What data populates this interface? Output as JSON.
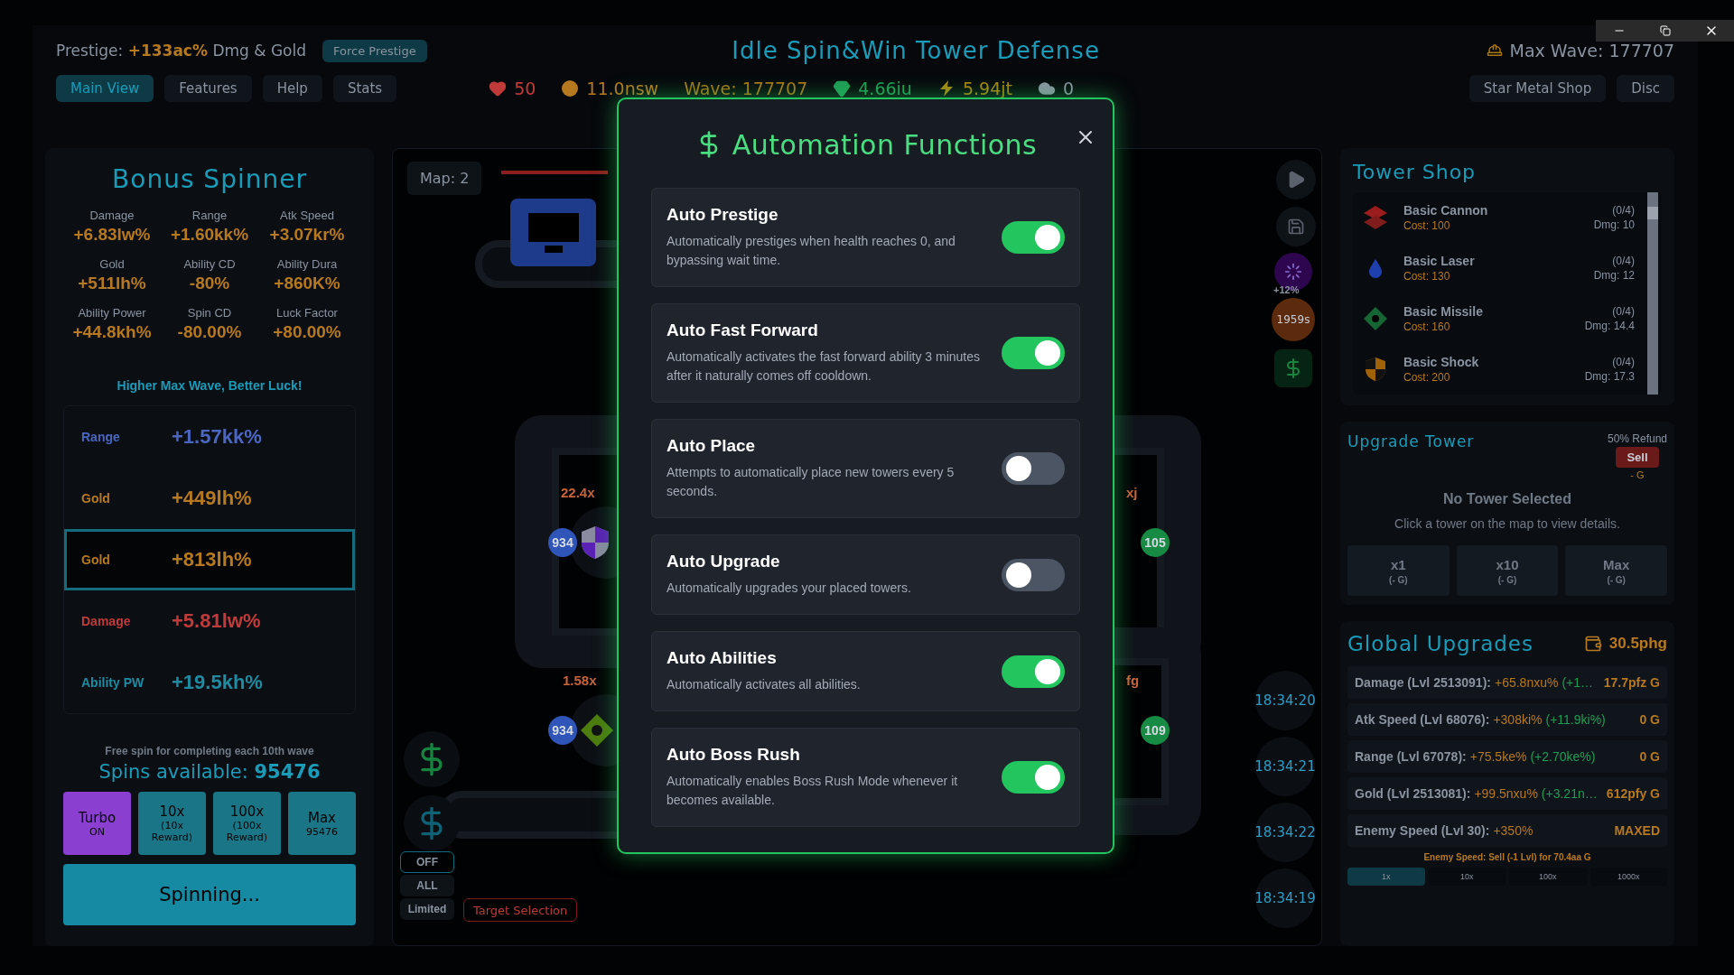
{
  "header": {
    "prestige_label": "Prestige:",
    "prestige_value": "+133ac%",
    "prestige_suffix": "Dmg & Gold",
    "force_prestige": "Force Prestige",
    "title": "Idle Spin&Win Tower Defense",
    "max_wave": "Max Wave: 177707"
  },
  "tabs": [
    {
      "label": "Main View",
      "selected": true
    },
    {
      "label": "Features",
      "selected": false
    },
    {
      "label": "Help",
      "selected": false
    },
    {
      "label": "Stats",
      "selected": false
    }
  ],
  "stats": [
    {
      "kind": "heart",
      "value": "50",
      "color": "#c03a3a"
    },
    {
      "kind": "coin",
      "value": "11.0nsw",
      "color": "#b7791f"
    },
    {
      "kind": "wave",
      "value": "Wave: 177707",
      "color": "#a8760f"
    },
    {
      "kind": "gem",
      "value": "4.66iu",
      "color": "#1f9d55"
    },
    {
      "kind": "bolt",
      "value": "5.94jt",
      "color": "#a8860c"
    },
    {
      "kind": "cloud",
      "value": "0",
      "color": "#8a93a0"
    }
  ],
  "top_links": [
    "Star Metal Shop",
    "Disc"
  ],
  "bonus_spinner": {
    "title": "Bonus Spinner",
    "stats": [
      {
        "label": "Damage",
        "value": "+6.83lw%"
      },
      {
        "label": "Range",
        "value": "+1.60kk%"
      },
      {
        "label": "Atk Speed",
        "value": "+3.07kr%"
      },
      {
        "label": "Gold",
        "value": "+511lh%"
      },
      {
        "label": "Ability CD",
        "value": "-80%"
      },
      {
        "label": "Ability Dura",
        "value": "+860K%"
      },
      {
        "label": "Ability Power",
        "value": "+44.8kh%"
      },
      {
        "label": "Spin CD",
        "value": "-80.00%"
      },
      {
        "label": "Luck Factor",
        "value": "+80.00%"
      }
    ],
    "tagline": "Higher Max Wave, Better Luck!",
    "reel": [
      {
        "label": "Range",
        "value": "+1.57kk%",
        "color": "#4a66c0",
        "selected": false
      },
      {
        "label": "Gold",
        "value": "+449lh%",
        "color": "#b7791f",
        "selected": false
      },
      {
        "label": "Gold",
        "value": "+813lh%",
        "color": "#b7791f",
        "selected": true
      },
      {
        "label": "Damage",
        "value": "+5.81lw%",
        "color": "#c03a3a",
        "selected": false
      },
      {
        "label": "Ability PW",
        "value": "+19.5kh%",
        "color": "#1f8aa0",
        "selected": false
      }
    ],
    "free_spin_note": "Free spin for completing each 10th wave",
    "spins_label": "Spins available:",
    "spins_value": "95476",
    "buttons": [
      {
        "kind": "turbo",
        "label": "Turbo",
        "sub": "ON"
      },
      {
        "kind": "batch",
        "label": "10x",
        "sub": "(10x Reward)"
      },
      {
        "kind": "batch",
        "label": "100x",
        "sub": "(100x Reward)"
      },
      {
        "kind": "batch",
        "label": "Max",
        "sub": "95476"
      }
    ],
    "spin_button": "Spinning..."
  },
  "map": {
    "label": "Map: 2",
    "towers": [
      {
        "kind": "shield",
        "badge": "934",
        "multiplier": "22.4x",
        "color": "#2f55b8"
      },
      {
        "kind": "diamond",
        "badge": "934",
        "multiplier": "1.58x",
        "color": "#2f55b8"
      },
      {
        "badge": "105",
        "multiplier": "xj",
        "color": "#178a44"
      },
      {
        "badge": "109",
        "multiplier": "fg",
        "color": "#178a44"
      }
    ],
    "boost": "+12%",
    "timer": "1959s",
    "clocks": [
      "18:34:20",
      "18:34:21",
      "18:34:22",
      "18:34:19"
    ],
    "target_modes": [
      "OFF",
      "ALL",
      "Limited"
    ],
    "target_selection": "Target Selection"
  },
  "tower_shop": {
    "title": "Tower Shop",
    "items": [
      {
        "kind": "cannon",
        "name": "Basic Cannon",
        "cost": "Cost: 100",
        "count": "(0/4)",
        "damage": "Dmg: 10"
      },
      {
        "kind": "laser",
        "name": "Basic Laser",
        "cost": "Cost: 130",
        "count": "(0/4)",
        "damage": "Dmg: 12"
      },
      {
        "kind": "missile",
        "name": "Basic Missile",
        "cost": "Cost: 160",
        "count": "(0/4)",
        "damage": "Dmg: 14.4"
      },
      {
        "kind": "shock",
        "name": "Basic Shock",
        "cost": "Cost: 200",
        "count": "(0/4)",
        "damage": "Dmg: 17.3"
      }
    ]
  },
  "upgrade_tower": {
    "title": "Upgrade Tower",
    "refund": "50% Refund",
    "sell": "Sell",
    "sell_value": "- G",
    "empty_title": "No Tower Selected",
    "empty_hint": "Click a tower on the map to view details.",
    "buttons": [
      {
        "label": "x1",
        "cost": "(- G)"
      },
      {
        "label": "x10",
        "cost": "(- G)"
      },
      {
        "label": "Max",
        "cost": "(- G)"
      }
    ]
  },
  "global_upgrades": {
    "title": "Global Upgrades",
    "balance": "30.5phg",
    "rows": [
      {
        "name": "Damage (Lvl 2513091):",
        "value": "+65.8nxu%",
        "delta": "(+1…",
        "cost": "17.7pfz G"
      },
      {
        "name": "Atk Speed (Lvl 68076):",
        "value": "+308ki%",
        "delta": "(+11.9ki%)",
        "cost": "0 G"
      },
      {
        "name": "Range (Lvl 67078):",
        "value": "+75.5ke%",
        "delta": "(+2.70ke%)",
        "cost": "0 G"
      },
      {
        "name": "Gold (Lvl 2513081):",
        "value": "+99.5nxu%",
        "delta": "(+3.21n…",
        "cost": "612pfy G"
      },
      {
        "name": "Enemy Speed (Lvl 30):",
        "value": "+350%",
        "cost": "MAXED"
      }
    ],
    "note": "Enemy Speed: Sell (-1 Lvl) for 70.4aa G",
    "multipliers": [
      {
        "label": "1x",
        "selected": true
      },
      {
        "label": "10x",
        "selected": false
      },
      {
        "label": "100x",
        "selected": false
      },
      {
        "label": "1000x",
        "selected": false
      }
    ]
  },
  "automation_modal": {
    "title": "Automation Functions",
    "items": [
      {
        "name": "Auto Prestige",
        "description": "Automatically prestiges when health reaches 0, and bypassing wait time.",
        "on": true
      },
      {
        "name": "Auto Fast Forward",
        "description": "Automatically activates the fast forward ability 3 minutes after it naturally comes off cooldown.",
        "on": true
      },
      {
        "name": "Auto Place",
        "description": "Attempts to automatically place new towers every 5 seconds.",
        "on": false
      },
      {
        "name": "Auto Upgrade",
        "description": "Automatically upgrades your placed towers.",
        "on": false
      },
      {
        "name": "Auto Abilities",
        "description": "Automatically activates all abilities.",
        "on": true
      },
      {
        "name": "Auto Boss Rush",
        "description": "Automatically enables Boss Rush Mode whenever it becomes available.",
        "on": true
      }
    ]
  }
}
